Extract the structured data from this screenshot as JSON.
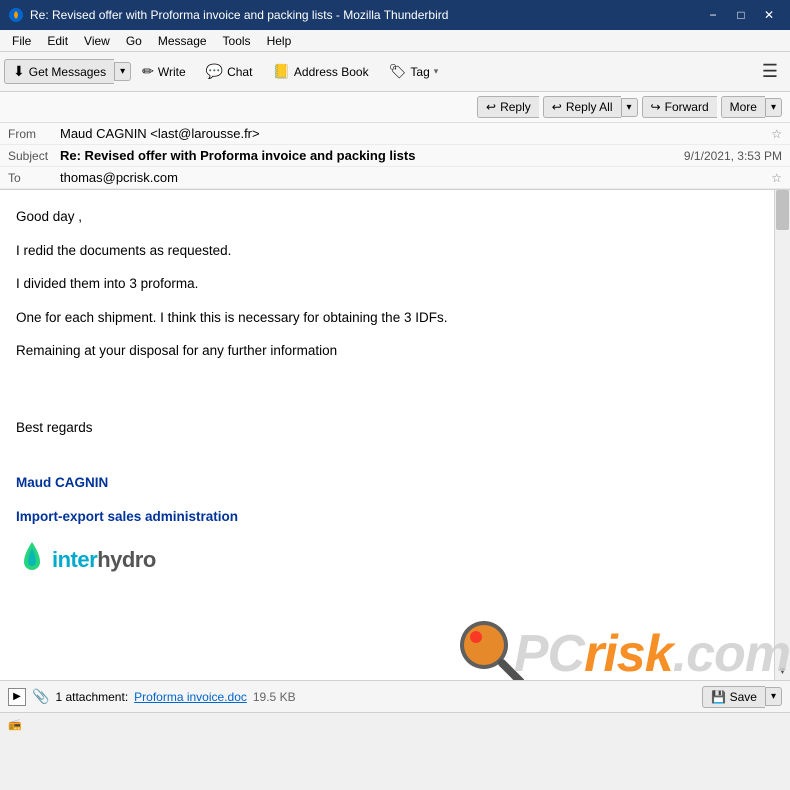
{
  "titlebar": {
    "title": "Re: Revised offer with Proforma invoice and packing lists - Mozilla Thunderbird",
    "minimize": "−",
    "maximize": "□",
    "close": "✕"
  },
  "menubar": {
    "items": [
      "File",
      "Edit",
      "View",
      "Go",
      "Message",
      "Tools",
      "Help"
    ]
  },
  "toolbar": {
    "get_messages": "Get Messages",
    "write": "Write",
    "chat": "Chat",
    "address_book": "Address Book",
    "tag": "Tag"
  },
  "actions": {
    "reply": "Reply",
    "reply_all": "Reply All",
    "forward": "Forward",
    "more": "More"
  },
  "email": {
    "from_label": "From",
    "from_value": "Maud CAGNIN <last@larousse.fr>",
    "subject_label": "Subject",
    "subject_value": "Re: Revised offer with Proforma invoice and packing lists",
    "date_value": "9/1/2021, 3:53 PM",
    "to_label": "To",
    "to_value": "thomas@pcrisk.com"
  },
  "body": {
    "line1": "Good day ,",
    "line2": "I redid the documents as requested.",
    "line3": "I divided them into 3 proforma.",
    "line4": "One for each shipment. I think this is necessary for obtaining the 3 IDFs.",
    "line5": "Remaining at your disposal for any further information",
    "line6": "Best regards",
    "sender_name": "Maud CAGNIN",
    "sender_title": "Import-export sales administration",
    "logo_inter": "inter",
    "logo_hydro": "hydro"
  },
  "attachment": {
    "count": "1 attachment:",
    "filename": "Proforma invoice.doc",
    "size": "19.5 KB",
    "save_label": "Save"
  },
  "statusbar": {
    "icon": "📻"
  },
  "watermark": {
    "text_pc": "PC",
    "text_risk": "risk",
    "text_com": ".com"
  }
}
